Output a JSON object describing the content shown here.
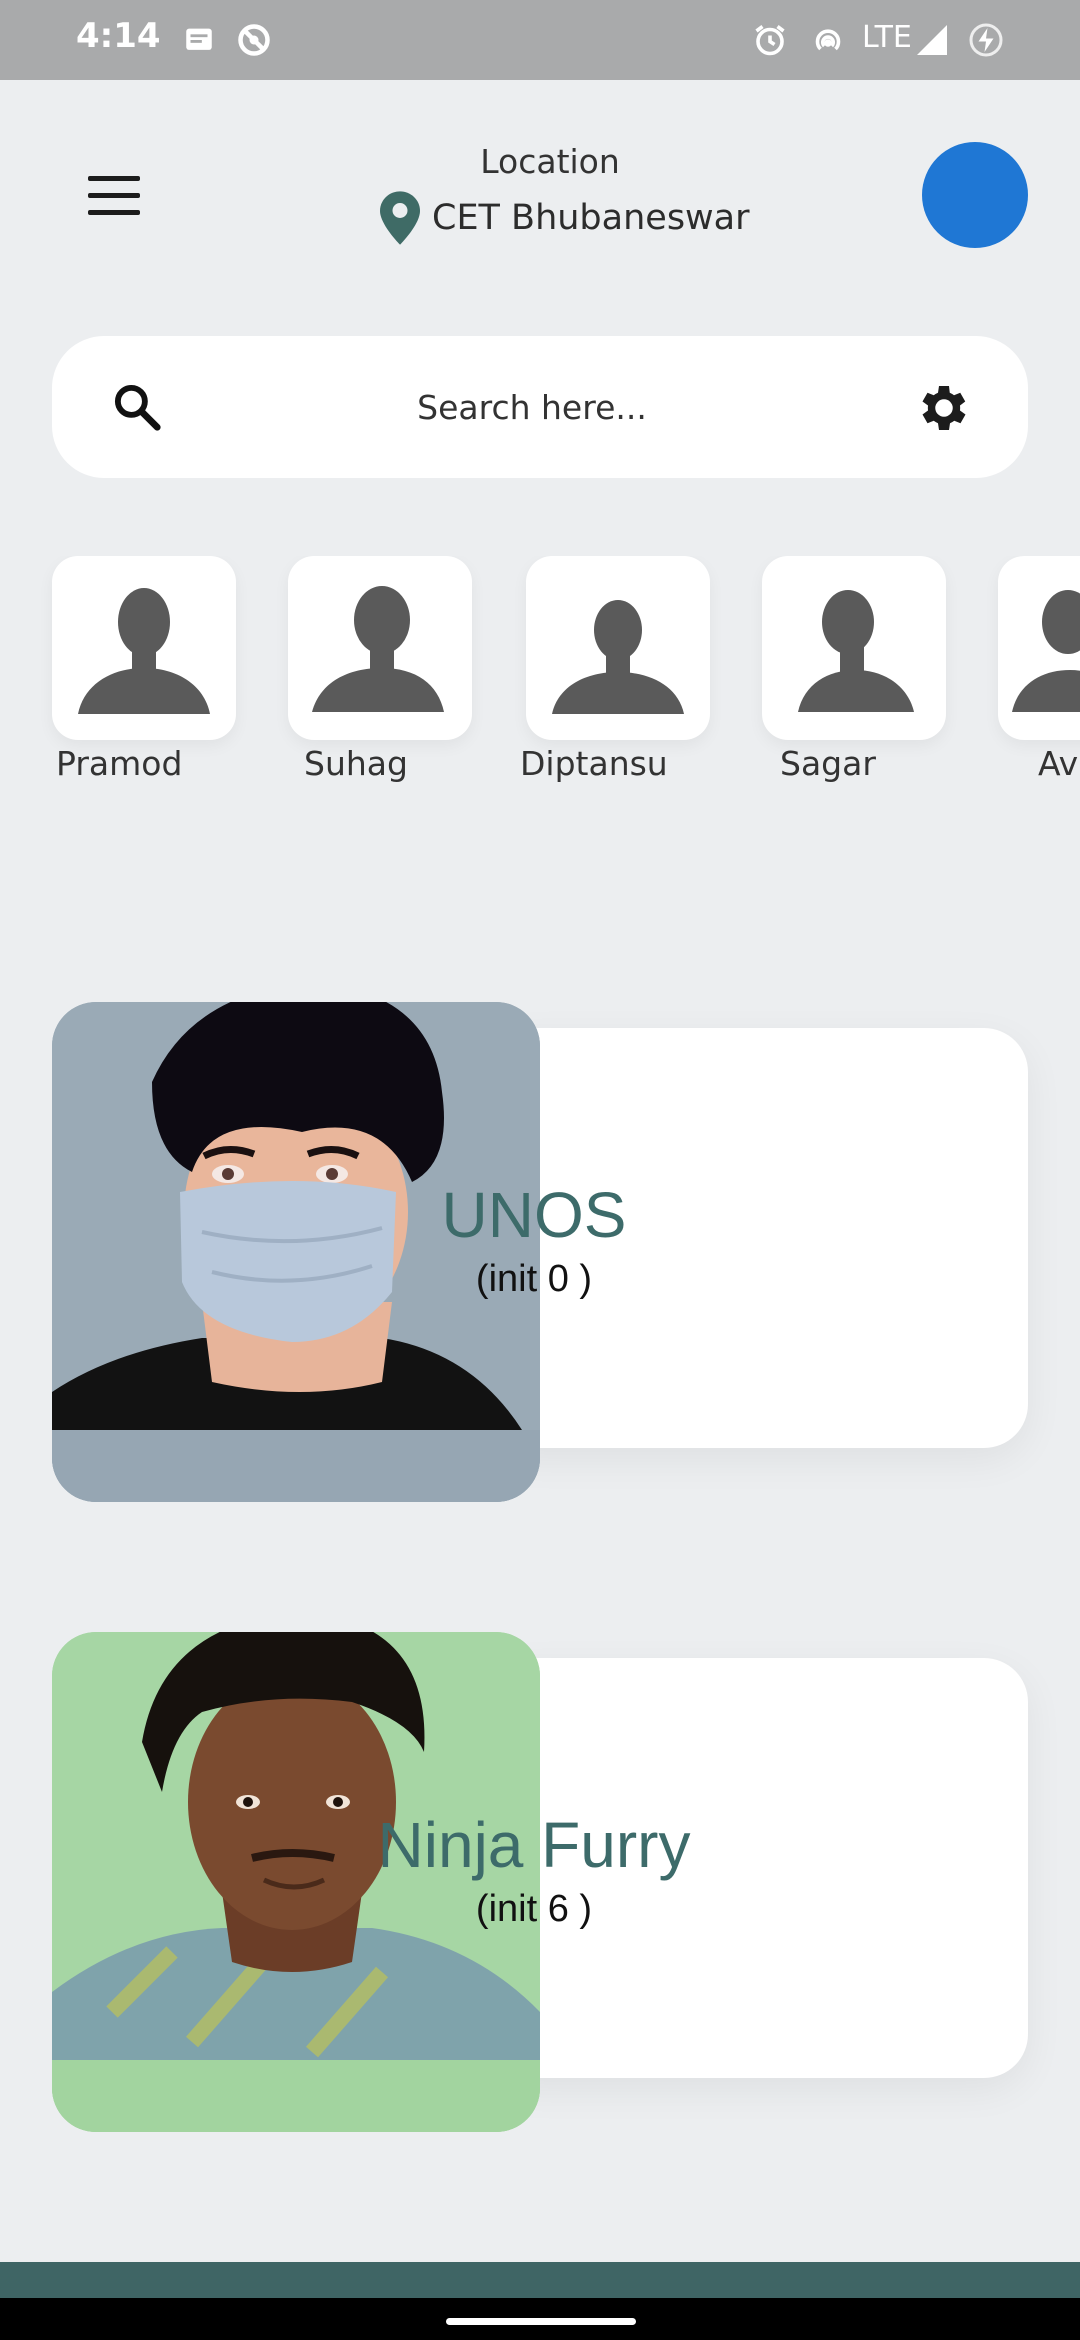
{
  "status_bar": {
    "time": "4:14",
    "network": "LTE",
    "icons": [
      "message-icon",
      "do-not-disturb-icon",
      "alarm-icon",
      "hotspot-icon",
      "signal-icon",
      "battery-charging-icon"
    ]
  },
  "header": {
    "menu_icon": "hamburger-menu-icon",
    "location_label": "Location",
    "location_icon": "map-pin-icon",
    "location_name": "CET Bhubaneswar",
    "avatar_color": "#1f77d4"
  },
  "search": {
    "placeholder": "Search here...",
    "search_icon": "search-icon",
    "settings_icon": "gear-icon"
  },
  "contacts": [
    {
      "name": "Pramod"
    },
    {
      "name": "Suhag"
    },
    {
      "name": "Diptansu"
    },
    {
      "name": "Sagar"
    },
    {
      "name": "Av"
    }
  ],
  "cards": [
    {
      "title": "UNOS",
      "subtitle": "(init 0 )",
      "photo_bg": "#9aaab6"
    },
    {
      "title": "Ninja Furry",
      "subtitle": "(init 6 )",
      "photo_bg": "#a6d6a4"
    }
  ],
  "colors": {
    "accent": "#3d6b6a",
    "bottom_band": "#3f6565"
  }
}
